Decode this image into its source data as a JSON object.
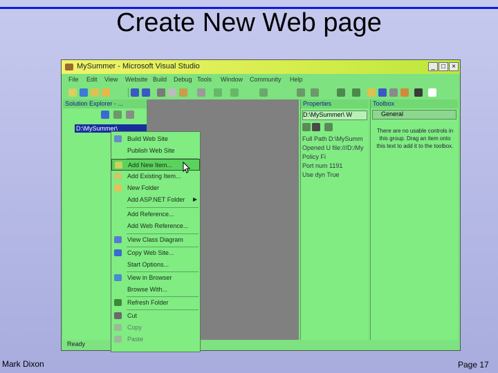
{
  "slide": {
    "title": "Create New Web page",
    "author": "Mark Dixon",
    "page": "Page 17"
  },
  "window": {
    "title": "MySummer - Microsoft Visual Studio",
    "controls": [
      "_",
      "□",
      "×"
    ],
    "menu": [
      "File",
      "Edit",
      "View",
      "Website",
      "Build",
      "Debug",
      "Tools",
      "Window",
      "Community",
      "Help"
    ]
  },
  "solution_explorer": {
    "title": "Solution Explorer - ...",
    "root_node": "D:\\MySummer\\"
  },
  "properties": {
    "title": "Properties",
    "selector": "D:\\MySummer\\ W",
    "rows": [
      {
        "name": "Full Path",
        "value": "D:\\MySumm"
      },
      {
        "name": "Opened U",
        "value": "file:///D:/My"
      },
      {
        "name": "Policy",
        "value": "Fi"
      },
      {
        "name": "Port num",
        "value": "1191"
      },
      {
        "name": "Use dyn",
        "value": "True"
      }
    ]
  },
  "toolbox": {
    "title": "Toolbox",
    "group": "General",
    "message": "There are no usable controls in this group. Drag an item onto this text to add it to the toolbox."
  },
  "context_menu": [
    {
      "label": "Build Web Site",
      "icon": "build-icon"
    },
    {
      "label": "Publish Web Site",
      "icon": "publish-icon"
    },
    {
      "label": "Add New Item...",
      "icon": "add-new-item-icon",
      "selected": true
    },
    {
      "label": "Add Existing Item...",
      "icon": "add-existing-item-icon"
    },
    {
      "label": "New Folder",
      "icon": "folder-icon"
    },
    {
      "label": "Add ASP.NET Folder",
      "icon": "submenu-arrow-icon"
    },
    {
      "label": "Add Reference...",
      "icon": "reference-icon"
    },
    {
      "label": "Add Web Reference...",
      "icon": "web-reference-icon"
    },
    {
      "label": "View Class Diagram",
      "icon": "class-diagram-icon"
    },
    {
      "label": "Copy Web Site...",
      "icon": "copy-web-icon"
    },
    {
      "label": "Start Options...",
      "icon": "options-icon"
    },
    {
      "label": "View in Browser",
      "icon": "browser-icon"
    },
    {
      "label": "Browse With...",
      "icon": "browse-with-icon"
    },
    {
      "label": "Refresh Folder",
      "icon": "refresh-icon"
    },
    {
      "label": "Cut",
      "icon": "cut-icon"
    },
    {
      "label": "Copy",
      "icon": "copy-icon"
    },
    {
      "label": "Paste",
      "icon": "paste-icon"
    }
  ],
  "status": "Ready",
  "colors": {
    "accent": "#0a1cd6",
    "ide_bg": "#7de27f",
    "selection": "#172f9c"
  }
}
